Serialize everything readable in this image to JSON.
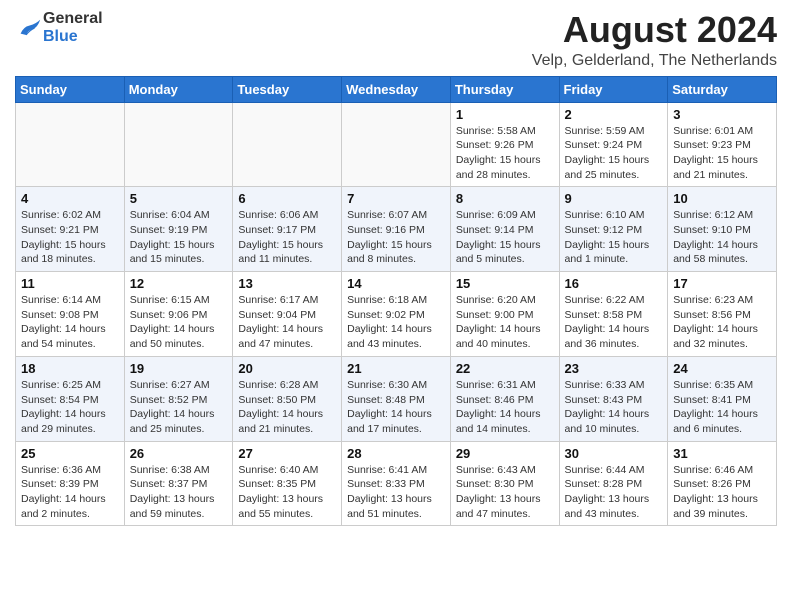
{
  "header": {
    "logo_general": "General",
    "logo_blue": "Blue",
    "month_title": "August 2024",
    "location": "Velp, Gelderland, The Netherlands"
  },
  "weekdays": [
    "Sunday",
    "Monday",
    "Tuesday",
    "Wednesday",
    "Thursday",
    "Friday",
    "Saturday"
  ],
  "weeks": [
    [
      {
        "day": "",
        "info": ""
      },
      {
        "day": "",
        "info": ""
      },
      {
        "day": "",
        "info": ""
      },
      {
        "day": "",
        "info": ""
      },
      {
        "day": "1",
        "info": "Sunrise: 5:58 AM\nSunset: 9:26 PM\nDaylight: 15 hours\nand 28 minutes."
      },
      {
        "day": "2",
        "info": "Sunrise: 5:59 AM\nSunset: 9:24 PM\nDaylight: 15 hours\nand 25 minutes."
      },
      {
        "day": "3",
        "info": "Sunrise: 6:01 AM\nSunset: 9:23 PM\nDaylight: 15 hours\nand 21 minutes."
      }
    ],
    [
      {
        "day": "4",
        "info": "Sunrise: 6:02 AM\nSunset: 9:21 PM\nDaylight: 15 hours\nand 18 minutes."
      },
      {
        "day": "5",
        "info": "Sunrise: 6:04 AM\nSunset: 9:19 PM\nDaylight: 15 hours\nand 15 minutes."
      },
      {
        "day": "6",
        "info": "Sunrise: 6:06 AM\nSunset: 9:17 PM\nDaylight: 15 hours\nand 11 minutes."
      },
      {
        "day": "7",
        "info": "Sunrise: 6:07 AM\nSunset: 9:16 PM\nDaylight: 15 hours\nand 8 minutes."
      },
      {
        "day": "8",
        "info": "Sunrise: 6:09 AM\nSunset: 9:14 PM\nDaylight: 15 hours\nand 5 minutes."
      },
      {
        "day": "9",
        "info": "Sunrise: 6:10 AM\nSunset: 9:12 PM\nDaylight: 15 hours\nand 1 minute."
      },
      {
        "day": "10",
        "info": "Sunrise: 6:12 AM\nSunset: 9:10 PM\nDaylight: 14 hours\nand 58 minutes."
      }
    ],
    [
      {
        "day": "11",
        "info": "Sunrise: 6:14 AM\nSunset: 9:08 PM\nDaylight: 14 hours\nand 54 minutes."
      },
      {
        "day": "12",
        "info": "Sunrise: 6:15 AM\nSunset: 9:06 PM\nDaylight: 14 hours\nand 50 minutes."
      },
      {
        "day": "13",
        "info": "Sunrise: 6:17 AM\nSunset: 9:04 PM\nDaylight: 14 hours\nand 47 minutes."
      },
      {
        "day": "14",
        "info": "Sunrise: 6:18 AM\nSunset: 9:02 PM\nDaylight: 14 hours\nand 43 minutes."
      },
      {
        "day": "15",
        "info": "Sunrise: 6:20 AM\nSunset: 9:00 PM\nDaylight: 14 hours\nand 40 minutes."
      },
      {
        "day": "16",
        "info": "Sunrise: 6:22 AM\nSunset: 8:58 PM\nDaylight: 14 hours\nand 36 minutes."
      },
      {
        "day": "17",
        "info": "Sunrise: 6:23 AM\nSunset: 8:56 PM\nDaylight: 14 hours\nand 32 minutes."
      }
    ],
    [
      {
        "day": "18",
        "info": "Sunrise: 6:25 AM\nSunset: 8:54 PM\nDaylight: 14 hours\nand 29 minutes."
      },
      {
        "day": "19",
        "info": "Sunrise: 6:27 AM\nSunset: 8:52 PM\nDaylight: 14 hours\nand 25 minutes."
      },
      {
        "day": "20",
        "info": "Sunrise: 6:28 AM\nSunset: 8:50 PM\nDaylight: 14 hours\nand 21 minutes."
      },
      {
        "day": "21",
        "info": "Sunrise: 6:30 AM\nSunset: 8:48 PM\nDaylight: 14 hours\nand 17 minutes."
      },
      {
        "day": "22",
        "info": "Sunrise: 6:31 AM\nSunset: 8:46 PM\nDaylight: 14 hours\nand 14 minutes."
      },
      {
        "day": "23",
        "info": "Sunrise: 6:33 AM\nSunset: 8:43 PM\nDaylight: 14 hours\nand 10 minutes."
      },
      {
        "day": "24",
        "info": "Sunrise: 6:35 AM\nSunset: 8:41 PM\nDaylight: 14 hours\nand 6 minutes."
      }
    ],
    [
      {
        "day": "25",
        "info": "Sunrise: 6:36 AM\nSunset: 8:39 PM\nDaylight: 14 hours\nand 2 minutes."
      },
      {
        "day": "26",
        "info": "Sunrise: 6:38 AM\nSunset: 8:37 PM\nDaylight: 13 hours\nand 59 minutes."
      },
      {
        "day": "27",
        "info": "Sunrise: 6:40 AM\nSunset: 8:35 PM\nDaylight: 13 hours\nand 55 minutes."
      },
      {
        "day": "28",
        "info": "Sunrise: 6:41 AM\nSunset: 8:33 PM\nDaylight: 13 hours\nand 51 minutes."
      },
      {
        "day": "29",
        "info": "Sunrise: 6:43 AM\nSunset: 8:30 PM\nDaylight: 13 hours\nand 47 minutes."
      },
      {
        "day": "30",
        "info": "Sunrise: 6:44 AM\nSunset: 8:28 PM\nDaylight: 13 hours\nand 43 minutes."
      },
      {
        "day": "31",
        "info": "Sunrise: 6:46 AM\nSunset: 8:26 PM\nDaylight: 13 hours\nand 39 minutes."
      }
    ]
  ]
}
